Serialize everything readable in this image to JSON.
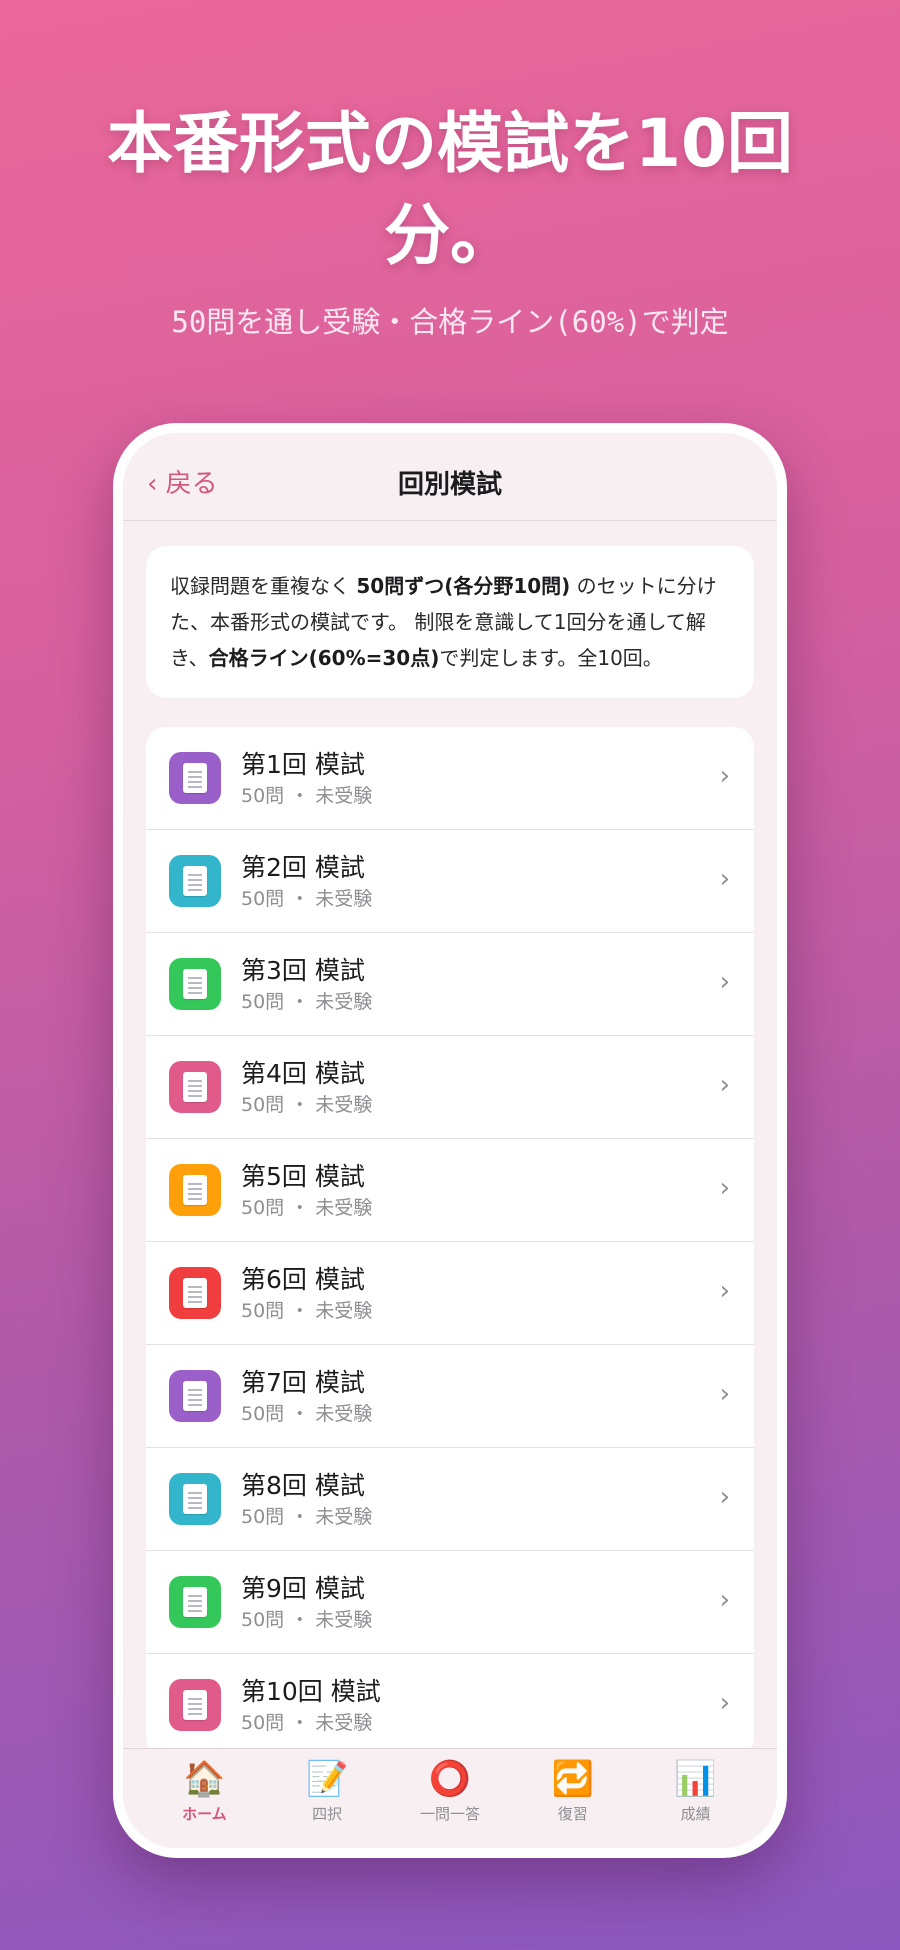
{
  "promo": {
    "headline": "本番形式の模試を10回分。",
    "subline": "50問を通し受験・合格ライン(60%)で判定"
  },
  "navbar": {
    "back_label": "‹ 戻る",
    "title": "回別模試"
  },
  "description": {
    "part1": "収録問題を重複なく ",
    "bold1": "50問ずつ(各分野10問)",
    "part2": " のセットに分けた、本番形式の模試です。 制限を意識して1回分を通して解き、",
    "bold2": "合格ライン(60%=30点)",
    "part3": "で判定します。全10回。"
  },
  "exams": [
    {
      "title": "第1回 模試",
      "sub": "50問 ・ 未受験",
      "color": "#9a5fc8",
      "icon": "document-icon"
    },
    {
      "title": "第2回 模試",
      "sub": "50問 ・ 未受験",
      "color": "#33b5cc",
      "icon": "document-icon"
    },
    {
      "title": "第3回 模試",
      "sub": "50問 ・ 未受験",
      "color": "#34c85a",
      "icon": "document-icon"
    },
    {
      "title": "第4回 模試",
      "sub": "50問 ・ 未受験",
      "color": "#e05a8a",
      "icon": "document-icon"
    },
    {
      "title": "第5回 模試",
      "sub": "50問 ・ 未受験",
      "color": "#ff9f0a",
      "icon": "document-icon"
    },
    {
      "title": "第6回 模試",
      "sub": "50問 ・ 未受験",
      "color": "#f03e3e",
      "icon": "document-icon"
    },
    {
      "title": "第7回 模試",
      "sub": "50問 ・ 未受験",
      "color": "#9a5fc8",
      "icon": "document-icon"
    },
    {
      "title": "第8回 模試",
      "sub": "50問 ・ 未受験",
      "color": "#33b5cc",
      "icon": "document-icon"
    },
    {
      "title": "第9回 模試",
      "sub": "50問 ・ 未受験",
      "color": "#34c85a",
      "icon": "document-icon"
    },
    {
      "title": "第10回 模試",
      "sub": "50問 ・ 未受験",
      "color": "#e05a8a",
      "icon": "document-icon"
    }
  ],
  "chevron": "›",
  "tabs": [
    {
      "label": "ホーム",
      "glyph": "🏠",
      "icon": "home-icon",
      "active": true
    },
    {
      "label": "四択",
      "glyph": "📝",
      "icon": "memo-icon",
      "active": false
    },
    {
      "label": "一問一答",
      "glyph": "⭕",
      "icon": "circle-icon",
      "active": false
    },
    {
      "label": "復習",
      "glyph": "🔁",
      "icon": "repeat-icon",
      "active": false
    },
    {
      "label": "成績",
      "glyph": "📊",
      "icon": "chart-icon",
      "active": false
    }
  ],
  "colors": {
    "accent": "#d4577f",
    "background_top": "#ea6799",
    "background_bottom": "#8a58bf"
  }
}
